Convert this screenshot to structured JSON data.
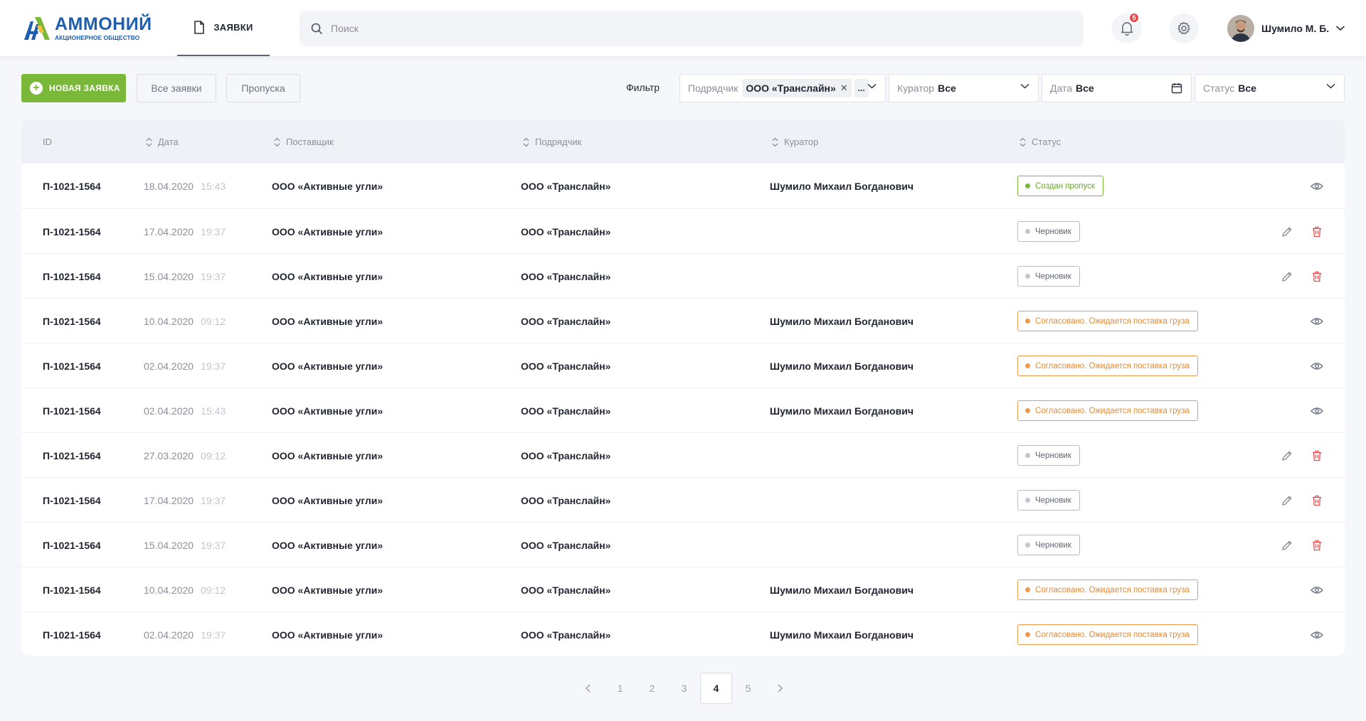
{
  "header": {
    "logo": {
      "name": "АММОНИЙ",
      "subtitle": "АКЦИОНЕРНОЕ ОБЩЕСТВО"
    },
    "nav_tab": {
      "label": "ЗАЯВКИ",
      "icon": "document-icon"
    },
    "search": {
      "placeholder": "Поиск",
      "value": ""
    },
    "notifications": {
      "count": "5",
      "icon": "bell-icon"
    },
    "settings_icon": "gear-icon",
    "user": {
      "name": "Шумило М. Б."
    }
  },
  "toolbar": {
    "new_request": "НОВАЯ ЗАЯВКА",
    "all_requests": "Все заявки",
    "passes": "Пропуска",
    "filter_label": "Фильтр",
    "contractor": {
      "label": "Подрядчик",
      "chip": "ООО «Транслайн»",
      "more": "..."
    },
    "curator": {
      "label": "Куратор",
      "value": "Все"
    },
    "date": {
      "label": "Дата",
      "value": "Все"
    },
    "status": {
      "label": "Статус",
      "value": "Все"
    }
  },
  "table": {
    "columns": [
      "ID",
      "Дата",
      "Поставщик",
      "Подрядчик",
      "Куратор",
      "Статус"
    ],
    "rows": [
      {
        "id": "П-1021-1564",
        "date": "18.04.2020",
        "time": "15:43",
        "supplier": "ООО «Активные угли»",
        "contractor": "ООО «Транслайн»",
        "curator": "Шумило Михаил Богданович",
        "status": "Создан пропуск",
        "status_type": "green",
        "actions": "view"
      },
      {
        "id": "П-1021-1564",
        "date": "17.04.2020",
        "time": "19:37",
        "supplier": "ООО «Активные угли»",
        "contractor": "ООО «Транслайн»",
        "curator": "",
        "status": "Черновик",
        "status_type": "gray",
        "actions": "edit"
      },
      {
        "id": "П-1021-1564",
        "date": "15.04.2020",
        "time": "19:37",
        "supplier": "ООО «Активные угли»",
        "contractor": "ООО «Транслайн»",
        "curator": "",
        "status": "Черновик",
        "status_type": "gray",
        "actions": "edit"
      },
      {
        "id": "П-1021-1564",
        "date": "10.04.2020",
        "time": "09:12",
        "supplier": "ООО «Активные угли»",
        "contractor": "ООО «Транслайн»",
        "curator": "Шумило Михаил Богданович",
        "status": "Согласовано. Ожидается поставка груза",
        "status_type": "orange",
        "actions": "view"
      },
      {
        "id": "П-1021-1564",
        "date": "02.04.2020",
        "time": "19:37",
        "supplier": "ООО «Активные угли»",
        "contractor": "ООО «Транслайн»",
        "curator": "Шумило Михаил Богданович",
        "status": "Согласовано. Ожидается поставка груза",
        "status_type": "orange",
        "actions": "view"
      },
      {
        "id": "П-1021-1564",
        "date": "02.04.2020",
        "time": "15:43",
        "supplier": "ООО «Активные угли»",
        "contractor": "ООО «Транслайн»",
        "curator": "Шумило Михаил Богданович",
        "status": "Согласовано. Ожидается поставка груза",
        "status_type": "orange",
        "actions": "view"
      },
      {
        "id": "П-1021-1564",
        "date": "27.03.2020",
        "time": "09:12",
        "supplier": "ООО «Активные угли»",
        "contractor": "ООО «Транслайн»",
        "curator": "",
        "status": "Черновик",
        "status_type": "gray",
        "actions": "edit"
      },
      {
        "id": "П-1021-1564",
        "date": "17.04.2020",
        "time": "19:37",
        "supplier": "ООО «Активные угли»",
        "contractor": "ООО «Транслайн»",
        "curator": "",
        "status": "Черновик",
        "status_type": "gray",
        "actions": "edit"
      },
      {
        "id": "П-1021-1564",
        "date": "15.04.2020",
        "time": "19:37",
        "supplier": "ООО «Активные угли»",
        "contractor": "ООО «Транслайн»",
        "curator": "",
        "status": "Черновик",
        "status_type": "gray",
        "actions": "edit"
      },
      {
        "id": "П-1021-1564",
        "date": "10.04.2020",
        "time": "09:12",
        "supplier": "ООО «Активные угли»",
        "contractor": "ООО «Транслайн»",
        "curator": "Шумило Михаил Богданович",
        "status": "Согласовано. Ожидается поставка груза",
        "status_type": "orange",
        "actions": "view"
      },
      {
        "id": "П-1021-1564",
        "date": "02.04.2020",
        "time": "19:37",
        "supplier": "ООО «Активные угли»",
        "contractor": "ООО «Транслайн»",
        "curator": "Шумило Михаил Богданович",
        "status": "Согласовано. Ожидается поставка груза",
        "status_type": "orange",
        "actions": "view"
      }
    ]
  },
  "pagination": {
    "pages": [
      "1",
      "2",
      "3",
      "4",
      "5"
    ],
    "current": "4"
  },
  "colors": {
    "accent_green": "#7ab83a",
    "brand_blue": "#1d5fae",
    "status_orange": "#f09a4a",
    "danger_red": "#e84a4a"
  }
}
